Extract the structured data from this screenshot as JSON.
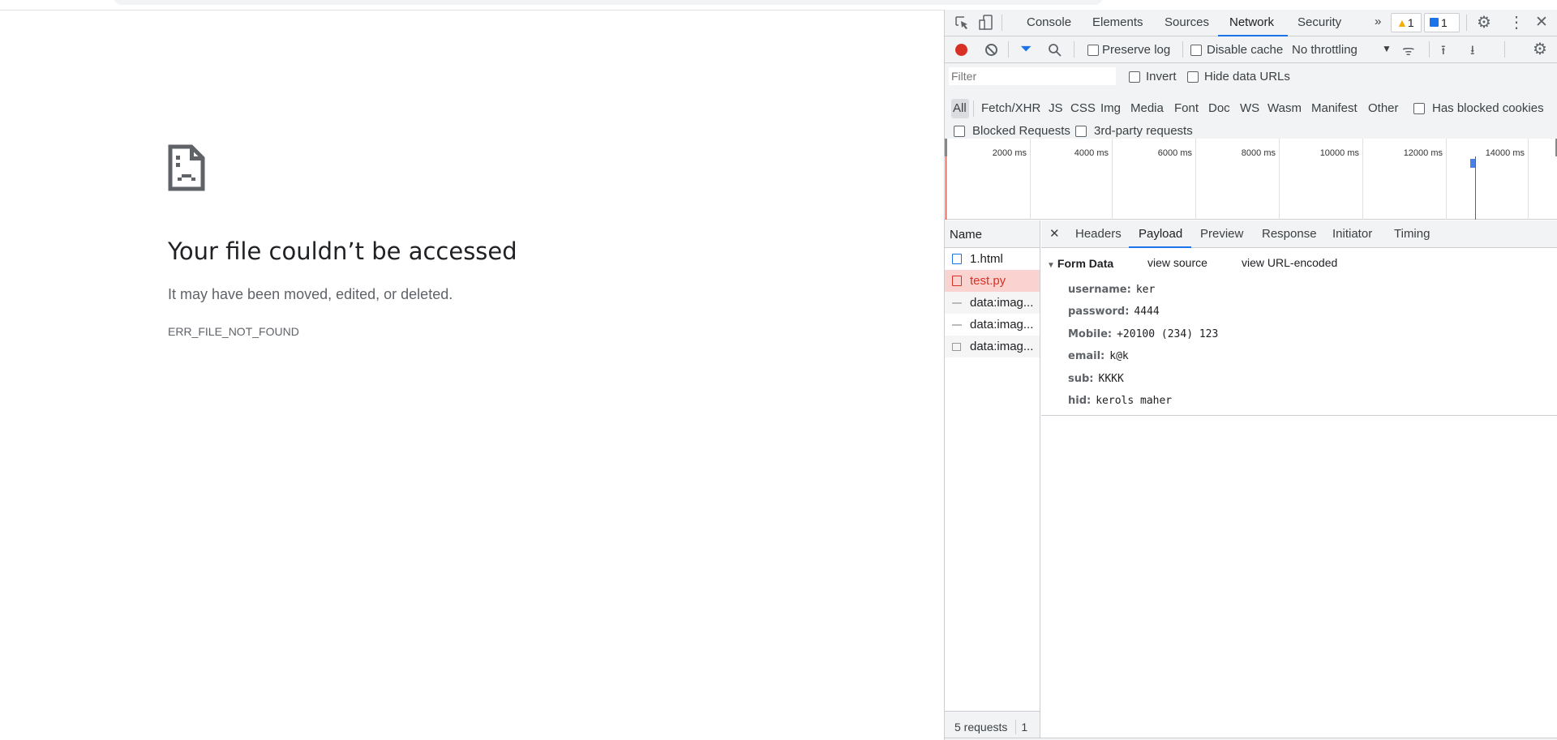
{
  "page": {
    "title": "Your file couldn’t be accessed",
    "subtitle": "It may have been moved, edited, or deleted.",
    "error_code": "ERR_FILE_NOT_FOUND"
  },
  "devtools": {
    "tabs": [
      "Console",
      "Elements",
      "Sources",
      "Network",
      "Security"
    ],
    "active_tab": "Network",
    "more": "»",
    "warnings": "1",
    "messages": "1",
    "toolbar": {
      "preserve_log": "Preserve log",
      "disable_cache": "Disable cache",
      "throttling": "No throttling"
    },
    "filter": {
      "placeholder": "Filter",
      "invert": "Invert",
      "hide_data_urls": "Hide data URLs"
    },
    "types": [
      "All",
      "Fetch/XHR",
      "JS",
      "CSS",
      "Img",
      "Media",
      "Font",
      "Doc",
      "WS",
      "Wasm",
      "Manifest",
      "Other"
    ],
    "has_blocked_cookies": "Has blocked cookies",
    "blocked_requests": "Blocked Requests",
    "third_party": "3rd-party requests",
    "timeline": [
      "2000 ms",
      "4000 ms",
      "6000 ms",
      "8000 ms",
      "10000 ms",
      "12000 ms",
      "14000 ms"
    ],
    "name_header": "Name",
    "requests": [
      {
        "name": "1.html",
        "type": "doc"
      },
      {
        "name": "test.py",
        "type": "doc",
        "selected": true,
        "error": true
      },
      {
        "name": "data:imag...",
        "type": "data"
      },
      {
        "name": "data:imag...",
        "type": "data"
      },
      {
        "name": "data:imag...",
        "type": "img"
      }
    ],
    "detail_tabs": [
      "Headers",
      "Payload",
      "Preview",
      "Response",
      "Initiator",
      "Timing"
    ],
    "active_detail_tab": "Payload",
    "form_data": {
      "title": "Form Data",
      "view_source": "view source",
      "view_url_encoded": "view URL-encoded",
      "fields": [
        {
          "key": "username:",
          "value": "ker"
        },
        {
          "key": "password:",
          "value": "4444"
        },
        {
          "key": "Mobile:",
          "value": "+20100 (234) 123"
        },
        {
          "key": "email:",
          "value": "k@k"
        },
        {
          "key": "sub:",
          "value": "KKKK"
        },
        {
          "key": "hid:",
          "value": "kerols maher"
        }
      ]
    },
    "footer": {
      "requests": "5 requests",
      "transferred": "1"
    }
  }
}
